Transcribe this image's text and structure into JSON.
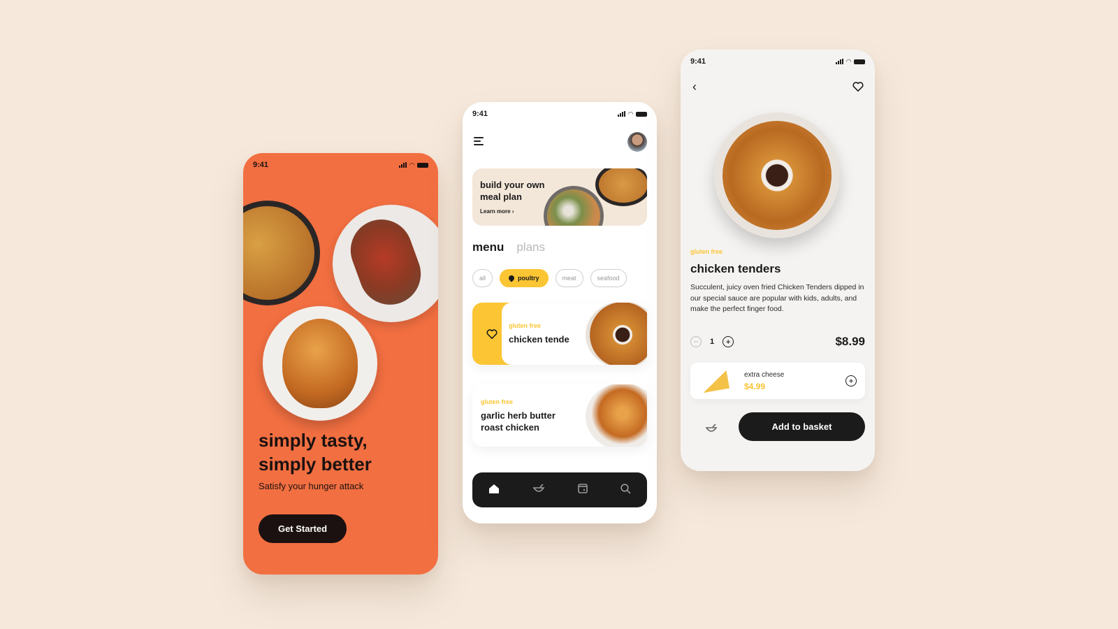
{
  "colors": {
    "background": "#f6e9dc",
    "brand_orange": "#f26f41",
    "accent_yellow": "#fcc534",
    "dark": "#1b1b1b"
  },
  "status_bar": {
    "time": "9:41"
  },
  "welcome": {
    "headline_line1": "simply tasty,",
    "headline_line2": "simply better",
    "subtitle": "Satisfy your hunger attack",
    "cta_label": "Get Started"
  },
  "menu_screen": {
    "banner": {
      "title": "build your own meal plan",
      "link_label": "Learn more ›"
    },
    "tabs": [
      {
        "label": "menu",
        "active": true
      },
      {
        "label": "plans",
        "active": false
      }
    ],
    "chips": [
      {
        "label": "all",
        "selected": false
      },
      {
        "label": "poultry",
        "selected": true,
        "icon": "drumstick-icon"
      },
      {
        "label": "meat",
        "selected": false
      },
      {
        "label": "seafood",
        "selected": false
      }
    ],
    "items": [
      {
        "tag": "gluten free",
        "name": "chicken tende",
        "favorite": true
      },
      {
        "tag": "gluten free",
        "name": "garlic herb butter roast chicken",
        "favorite": false
      }
    ],
    "nav": [
      {
        "icon": "home-icon",
        "glyph": "⌂",
        "active": true
      },
      {
        "icon": "bowl-icon",
        "glyph": "◡",
        "active": false
      },
      {
        "icon": "calendar-icon",
        "glyph": "▣",
        "active": false
      },
      {
        "icon": "search-icon",
        "glyph": "⚲",
        "active": false
      }
    ]
  },
  "detail_screen": {
    "tag": "gluten free",
    "title": "chicken tenders",
    "description": "Succulent, juicy oven fried Chicken Tenders dipped in our special sauce are popular with kids, adults, and make the perfect finger food.",
    "quantity": "1",
    "price": "$8.99",
    "addon": {
      "name": "extra cheese",
      "price": "$4.99"
    },
    "add_button_label": "Add to basket"
  }
}
